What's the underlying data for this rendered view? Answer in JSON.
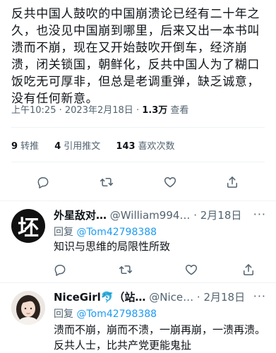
{
  "tweet": {
    "text": "反共中国人鼓吹的中国崩溃论已经有二十年之久，也没见中国崩到哪里，后来又出一本书叫溃而不崩，现在又开始鼓吹开倒车，经济崩溃，闭关锁国，朝鲜化，反共中国人为了糊口饭吃无可厚非，但总是老调重弹，缺乏诚意，没有任何新意。",
    "time": "上午10:25",
    "date": "2023年2月18日",
    "views_count": "1.3万",
    "views_label": "查看",
    "separator": "·"
  },
  "stats": {
    "retweets_count": "9",
    "retweets_label": "转推",
    "quotes_count": "4",
    "quotes_label": "引用推文",
    "likes_count": "143",
    "likes_label": "喜欢次数"
  },
  "actions": {
    "icons": [
      "reply-icon",
      "retweet-icon",
      "like-icon",
      "share-icon"
    ]
  },
  "replies": [
    {
      "avatar_text": "坯",
      "name": "外星敌对…",
      "handle": "@William994…",
      "separator": "·",
      "date": "2月18日",
      "more": "···",
      "replying_label": "回复",
      "replying_to": "@Tom42798388",
      "text": "知识与思维的局限性所致"
    },
    {
      "name": "NiceGirl🐬（站…",
      "handle": "@Nice…",
      "separator": "·",
      "date": "2月18日",
      "more": "···",
      "replying_label": "回复",
      "replying_to": "@Tom42798388",
      "text": "溃而不崩，崩而不溃，一崩再崩，一溃再溃。反共人士，比共产党更能鬼扯"
    }
  ],
  "colors": {
    "text": "#0f1419",
    "secondary": "#536471",
    "link": "#1d9bf0",
    "divider": "#eff3f4"
  }
}
